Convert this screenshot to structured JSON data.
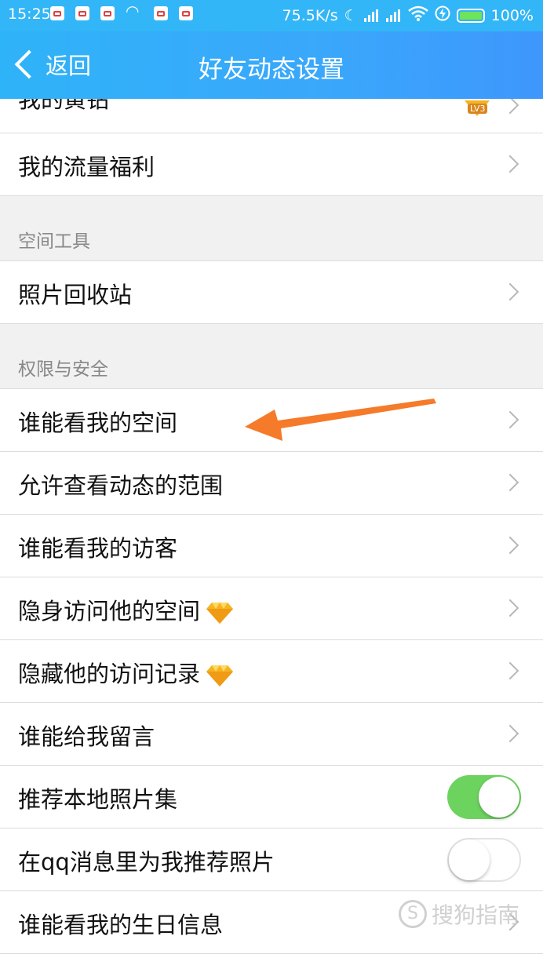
{
  "status_bar": {
    "time": "15:25",
    "network_speed": "75.5K/s",
    "battery": "100%"
  },
  "nav": {
    "back_label": "返回",
    "title": "好友动态设置"
  },
  "items": {
    "partial_top": "我的黄钻",
    "flow_welfare": "我的流量福利",
    "section_tools": "空间工具",
    "photo_recycle": "照片回收站",
    "section_privacy": "权限与安全",
    "who_can_see_space": "谁能看我的空间",
    "feed_range": "允许查看动态的范围",
    "who_can_see_visitors": "谁能看我的访客",
    "invisible_visit": "隐身访问他的空间",
    "hide_visit_record": "隐藏他的访问记录",
    "who_can_comment": "谁能给我留言",
    "recommend_local_photos": "推荐本地照片集",
    "recommend_in_qq": "在qq消息里为我推荐照片",
    "birthday_info": "谁能看我的生日信息"
  },
  "toggles": {
    "recommend_local_photos": true,
    "recommend_in_qq": false
  },
  "badge": {
    "level": "LV3"
  },
  "watermark": {
    "text": "搜狗指南"
  },
  "colors": {
    "nav_blue": "#32b6f7",
    "toggle_green": "#6dd35f",
    "annotation_orange": "#f57a2a",
    "diamond_gold": "#f5b521"
  }
}
